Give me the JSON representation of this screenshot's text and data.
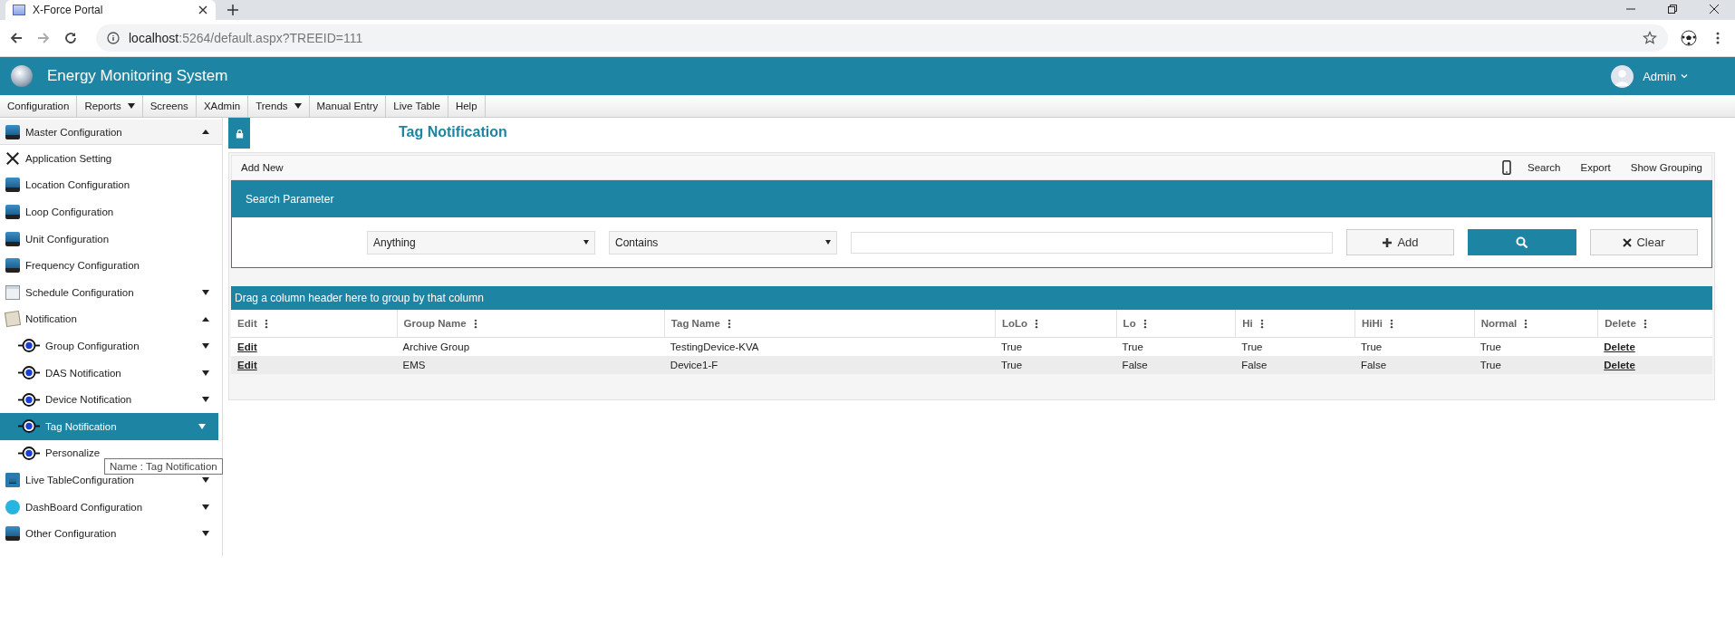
{
  "browser": {
    "tab_title": "X-Force Portal",
    "url_host": "localhost",
    "url_rest": ":5264/default.aspx?TREEID=111"
  },
  "header": {
    "app_title": "Energy Monitoring System",
    "user": "Admin"
  },
  "menu": [
    {
      "label": "Configuration",
      "dropdown": false
    },
    {
      "label": "Reports",
      "dropdown": true
    },
    {
      "label": "Screens",
      "dropdown": false
    },
    {
      "label": "XAdmin",
      "dropdown": false
    },
    {
      "label": "Trends",
      "dropdown": true
    },
    {
      "label": "Manual Entry",
      "dropdown": false
    },
    {
      "label": "Live Table",
      "dropdown": false
    },
    {
      "label": "Help",
      "dropdown": false
    }
  ],
  "sidebar": {
    "items": [
      {
        "label": "Master Configuration",
        "kind": "monitor",
        "expanded": true,
        "selected": false,
        "children": [
          {
            "label": "Application Setting",
            "kind": "tools",
            "selected": false
          },
          {
            "label": "Location Configuration",
            "kind": "monitor",
            "selected": false
          },
          {
            "label": "Loop Configuration",
            "kind": "monitor",
            "selected": false
          },
          {
            "label": "Unit Configuration",
            "kind": "monitor",
            "selected": false
          },
          {
            "label": "Frequency Configuration",
            "kind": "monitor",
            "selected": false
          },
          {
            "label": "Schedule Configuration",
            "kind": "calendar",
            "expanded": false,
            "selected": false
          },
          {
            "label": "Notification",
            "kind": "note",
            "expanded": true,
            "selected": false,
            "children": [
              {
                "label": "Group Configuration",
                "kind": "node",
                "expanded": false,
                "selected": false
              },
              {
                "label": "DAS Notification",
                "kind": "node",
                "expanded": false,
                "selected": false
              },
              {
                "label": "Device Notification",
                "kind": "node",
                "expanded": false,
                "selected": false
              },
              {
                "label": "Tag Notification",
                "kind": "node",
                "expanded": false,
                "selected": true
              },
              {
                "label": "Personalize",
                "kind": "node",
                "selected": false,
                "tooltip": "Name : Tag Notification"
              }
            ]
          },
          {
            "label": "Live TableConfiguration",
            "kind": "lock",
            "expanded": false,
            "selected": false
          },
          {
            "label": "DashBoard Configuration",
            "kind": "bulb",
            "expanded": false,
            "selected": false
          },
          {
            "label": "Other Configuration",
            "kind": "monitor",
            "expanded": false,
            "selected": false
          }
        ]
      }
    ]
  },
  "page_title": "Tag Notification",
  "toolbar": {
    "add_new": "Add New",
    "actions": [
      "Search",
      "Export",
      "Show Grouping"
    ]
  },
  "search_panel": {
    "title": "Search Parameter",
    "field_select": "Anything",
    "operator_select": "Contains",
    "add_button": "Add",
    "clear_button": "Clear"
  },
  "group_bar": "Drag a column header here to group by that column",
  "table": {
    "columns": [
      "Edit",
      "Group Name",
      "Tag Name",
      "LoLo",
      "Lo",
      "Hi",
      "HiHi",
      "Normal",
      "Delete"
    ],
    "rows": [
      [
        "Edit",
        "Archive Group",
        "TestingDevice-KVA",
        "True",
        "True",
        "True",
        "True",
        "True",
        "Delete"
      ],
      [
        "Edit",
        "EMS",
        "Device1-F",
        "True",
        "False",
        "False",
        "False",
        "True",
        "Delete"
      ]
    ]
  }
}
